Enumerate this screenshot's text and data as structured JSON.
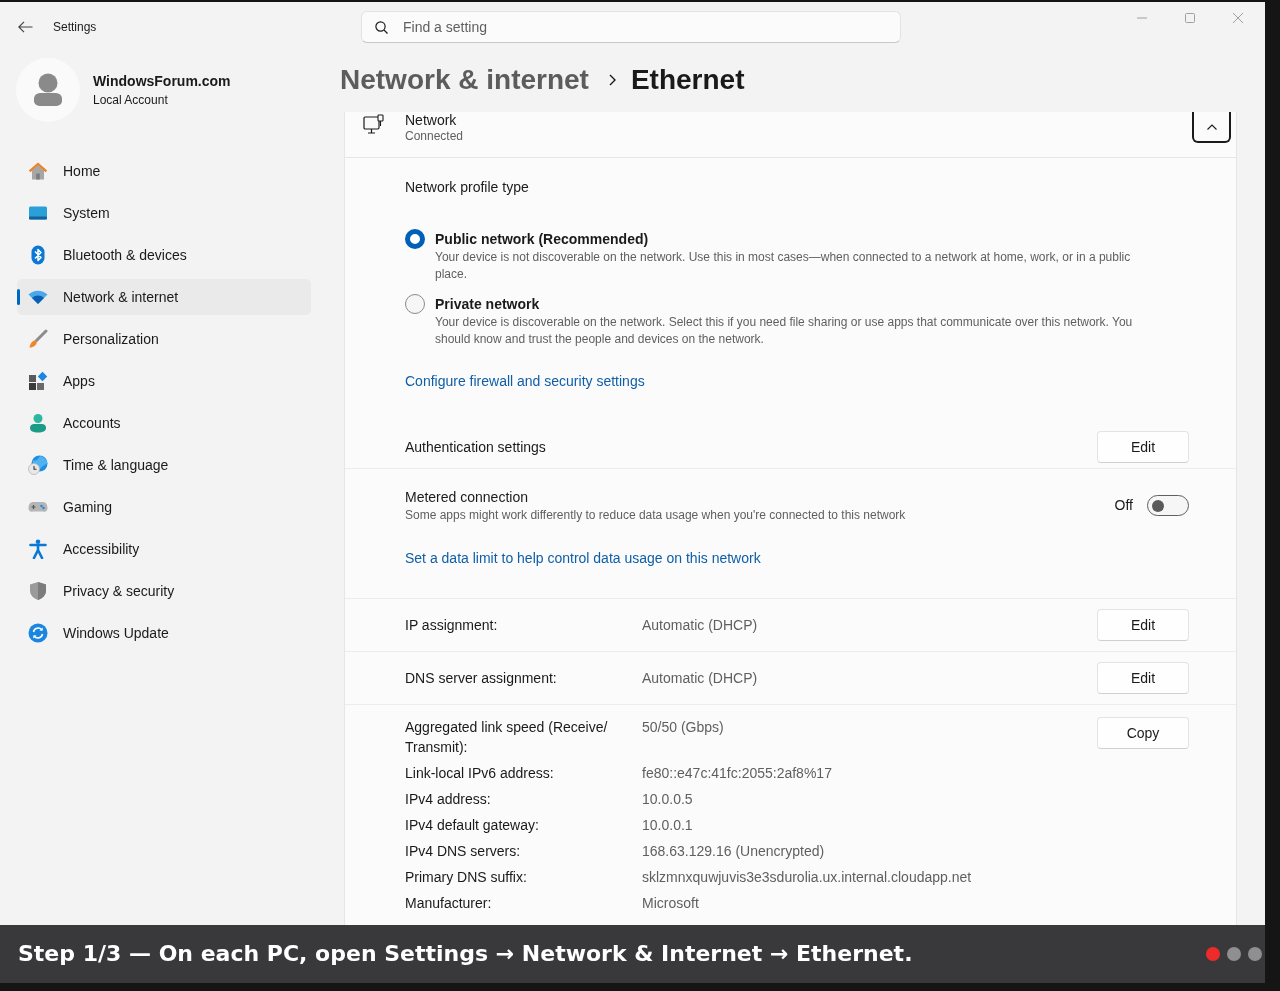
{
  "window": {
    "title": "Settings"
  },
  "account": {
    "name": "WindowsForum.com",
    "type": "Local Account"
  },
  "sidebar": {
    "items": [
      {
        "label": "Home",
        "selected": false
      },
      {
        "label": "System",
        "selected": false
      },
      {
        "label": "Bluetooth & devices",
        "selected": false
      },
      {
        "label": "Network & internet",
        "selected": true
      },
      {
        "label": "Personalization",
        "selected": false
      },
      {
        "label": "Apps",
        "selected": false
      },
      {
        "label": "Accounts",
        "selected": false
      },
      {
        "label": "Time & language",
        "selected": false
      },
      {
        "label": "Gaming",
        "selected": false
      },
      {
        "label": "Accessibility",
        "selected": false
      },
      {
        "label": "Privacy & security",
        "selected": false
      },
      {
        "label": "Windows Update",
        "selected": false
      }
    ]
  },
  "search": {
    "placeholder": "Find a setting"
  },
  "breadcrumb": {
    "parent": "Network & internet",
    "current": "Ethernet"
  },
  "network": {
    "title": "Network",
    "status": "Connected",
    "expanded": true
  },
  "profile": {
    "heading": "Network profile type",
    "options": [
      {
        "label": "Public network (Recommended)",
        "description": "Your device is not discoverable on the network. Use this in most cases—when connected to a network at home, work, or in a public place.",
        "selected": true
      },
      {
        "label": "Private network",
        "description": "Your device is discoverable on the network. Select this if you need file sharing or use apps that communicate over this network. You should know and trust the people and devices on the network.",
        "selected": false
      }
    ],
    "link": "Configure firewall and security settings"
  },
  "authentication": {
    "label": "Authentication settings",
    "button": "Edit"
  },
  "metered": {
    "label": "Metered connection",
    "description": "Some apps might work differently to reduce data usage when you're connected to this network",
    "state": "Off",
    "on": false,
    "link": "Set a data limit to help control data usage on this network"
  },
  "assignments": [
    {
      "label": "IP assignment:",
      "value": "Automatic (DHCP)",
      "button": "Edit"
    },
    {
      "label": "DNS server assignment:",
      "value": "Automatic (DHCP)",
      "button": "Edit"
    }
  ],
  "properties": {
    "button": "Copy",
    "rows": [
      {
        "label": "Aggregated link speed (Receive/Transmit):",
        "value": "50/50 (Gbps)"
      },
      {
        "label": "Link-local IPv6 address:",
        "value": "fe80::e47c:41fc:2055:2af8%17"
      },
      {
        "label": "IPv4 address:",
        "value": "10.0.0.5"
      },
      {
        "label": "IPv4 default gateway:",
        "value": "10.0.0.1"
      },
      {
        "label": "IPv4 DNS servers:",
        "value": "168.63.129.16 (Unencrypted)"
      },
      {
        "label": "Primary DNS suffix:",
        "value": "sklzmnxquwjuvis3e3sdurolia.ux.internal.cloudapp.net"
      },
      {
        "label": "Manufacturer:",
        "value": "Microsoft"
      }
    ]
  },
  "caption": {
    "text": "Step 1/3 — On each PC, open Settings → Network & Internet → Ethernet.",
    "steps": [
      {
        "selected": true
      },
      {
        "selected": false
      },
      {
        "selected": false
      }
    ]
  }
}
